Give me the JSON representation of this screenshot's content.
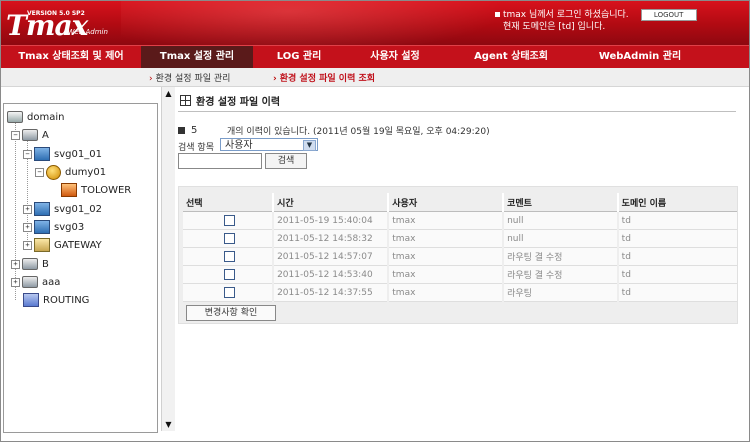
{
  "header": {
    "logo_version": "VERSION 5.0 SP2",
    "logo_main": "Tmax",
    "logo_sub": "/ Web Admin",
    "login_message": "tmax 님께서 로그인 하셨습니다.",
    "logout_label": "LOGOUT",
    "domain_message": "현재 도메인은 [td] 입니다."
  },
  "nav": {
    "tabs": [
      {
        "label": "Tmax 상태조회 및 제어"
      },
      {
        "label": "Tmax 설정 관리"
      },
      {
        "label": "LOG 관리"
      },
      {
        "label": "사용자 설정"
      },
      {
        "label": "Agent 상태조회"
      },
      {
        "label": "WebAdmin 관리"
      }
    ]
  },
  "subnav": {
    "items": [
      {
        "label": "환경 설정 파일 관리"
      },
      {
        "label": "환경 설정 파일 이력 조회"
      }
    ]
  },
  "tree": {
    "nodes": [
      {
        "label": "domain"
      },
      {
        "label": "A"
      },
      {
        "label": "svg01_01"
      },
      {
        "label": "dumy01"
      },
      {
        "label": "TOLOWER"
      },
      {
        "label": "svg01_02"
      },
      {
        "label": "svg03"
      },
      {
        "label": "GATEWAY"
      },
      {
        "label": "B"
      },
      {
        "label": "aaa"
      },
      {
        "label": "ROUTING"
      }
    ]
  },
  "main": {
    "title": "환경 설정 파일 이력",
    "count": "5",
    "count_text": "개의 이력이 있습니다. (2011년 05월 19일 목요일, 오후 04:29:20)",
    "search_label": "검색 항목",
    "search_selected": "사용자",
    "search_value": "",
    "search_button": "검색",
    "confirm_button": "변경사항 확인"
  },
  "table": {
    "headers": [
      "선택",
      "시간",
      "사용자",
      "코멘트",
      "도메인 이름"
    ],
    "rows": [
      {
        "time": "2011-05-19 15:40:04",
        "user": "tmax",
        "comment": "null",
        "domain": "td"
      },
      {
        "time": "2011-05-12 14:58:32",
        "user": "tmax",
        "comment": "null",
        "domain": "td"
      },
      {
        "time": "2011-05-12 14:57:07",
        "user": "tmax",
        "comment": "라우팅 결 수정",
        "domain": "td"
      },
      {
        "time": "2011-05-12 14:53:40",
        "user": "tmax",
        "comment": "라우팅 결 수정",
        "domain": "td"
      },
      {
        "time": "2011-05-12 14:37:55",
        "user": "tmax",
        "comment": "라우팅",
        "domain": "td"
      }
    ]
  }
}
